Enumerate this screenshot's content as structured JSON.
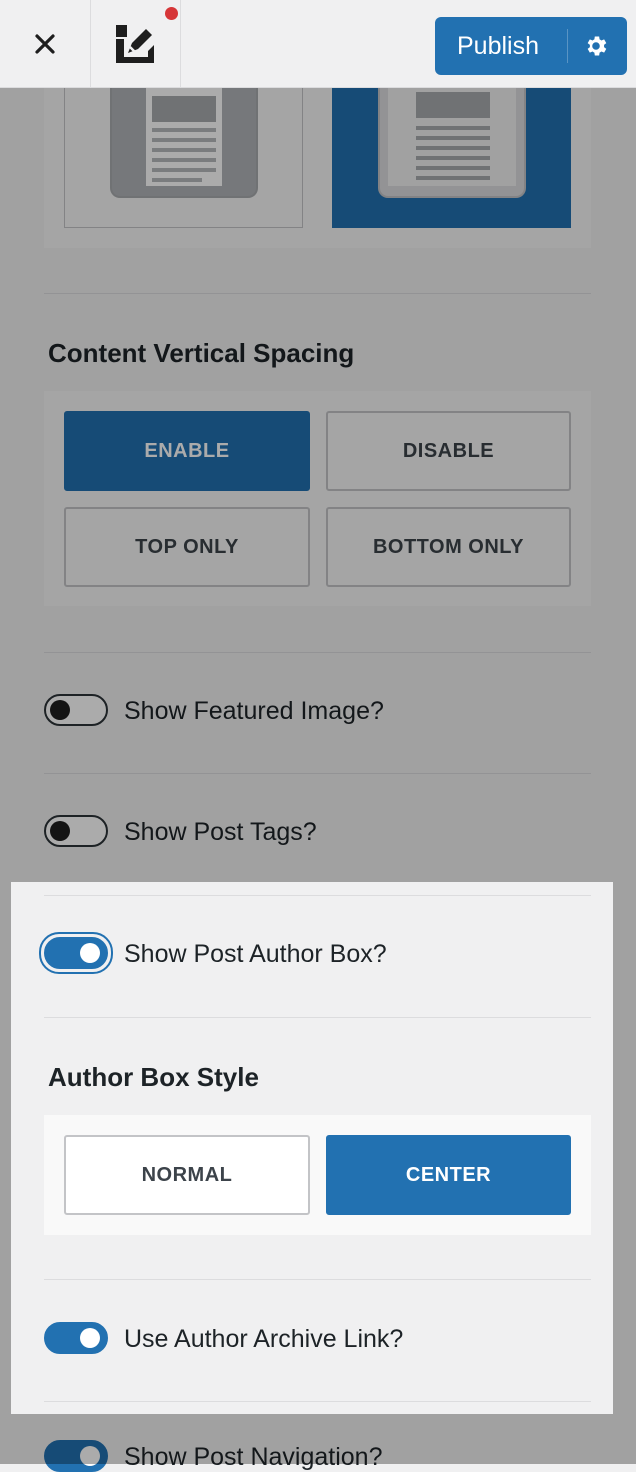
{
  "header": {
    "close_icon": "close-icon",
    "customize_icon": "customize-brush-icon",
    "publish_label": "Publish",
    "settings_icon": "gear-icon"
  },
  "content_vertical_spacing": {
    "title": "Content Vertical Spacing",
    "options": [
      "ENABLE",
      "DISABLE",
      "TOP ONLY",
      "BOTTOM ONLY"
    ],
    "selected": "ENABLE"
  },
  "toggles": {
    "featured_image": {
      "label": "Show Featured Image?",
      "on": false
    },
    "post_tags": {
      "label": "Show Post Tags?",
      "on": false
    },
    "author_box": {
      "label": "Show Post Author Box?",
      "on": true
    },
    "author_archive": {
      "label": "Use Author Archive Link?",
      "on": true
    },
    "post_navigation": {
      "label": "Show Post Navigation?",
      "on": true
    }
  },
  "author_box_style": {
    "title": "Author Box Style",
    "options": [
      "NORMAL",
      "CENTER"
    ],
    "selected": "CENTER"
  },
  "colors": {
    "accent": "#2271b1",
    "notification": "#d63638"
  }
}
